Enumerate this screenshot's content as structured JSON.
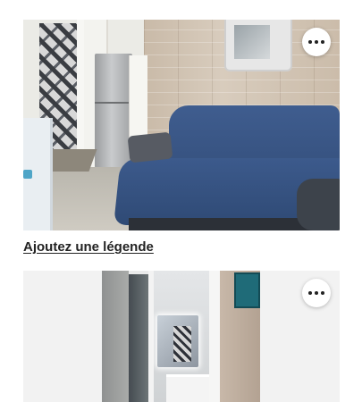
{
  "photos": [
    {
      "caption_link": "Ajoutez une légende",
      "menu_icon": "more-horizontal-icon"
    },
    {
      "menu_icon": "more-horizontal-icon"
    }
  ],
  "colors": {
    "text": "#222222",
    "card_background": "#f2f2f2",
    "button_background": "#ffffff"
  }
}
